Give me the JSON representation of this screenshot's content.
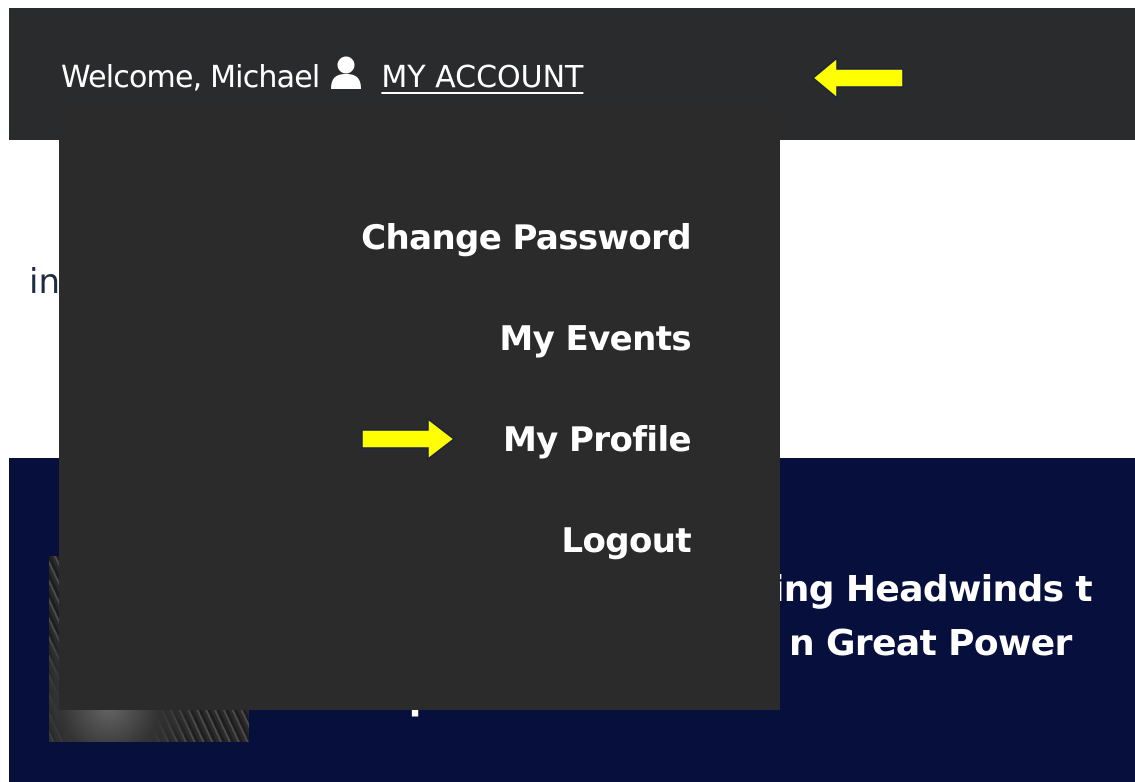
{
  "header": {
    "welcome": "Welcome, Michael",
    "account_label": "MY ACCOUNT",
    "user_icon": "user-icon",
    "background": "#2a2b2c"
  },
  "account_menu": {
    "items": [
      {
        "label": "Change Password"
      },
      {
        "label": "My Events"
      },
      {
        "label": "My Profile"
      },
      {
        "label": "Logout"
      }
    ],
    "background": "#2b2b2b"
  },
  "annotations": {
    "arrow_color": "#ffff00",
    "arrow_icon": "arrow-icon"
  },
  "page": {
    "side_text": "in"
  },
  "hero": {
    "title_lines": [
      "ing Headwinds t",
      "n Great Power",
      "Competition"
    ],
    "background": "#07103d"
  }
}
